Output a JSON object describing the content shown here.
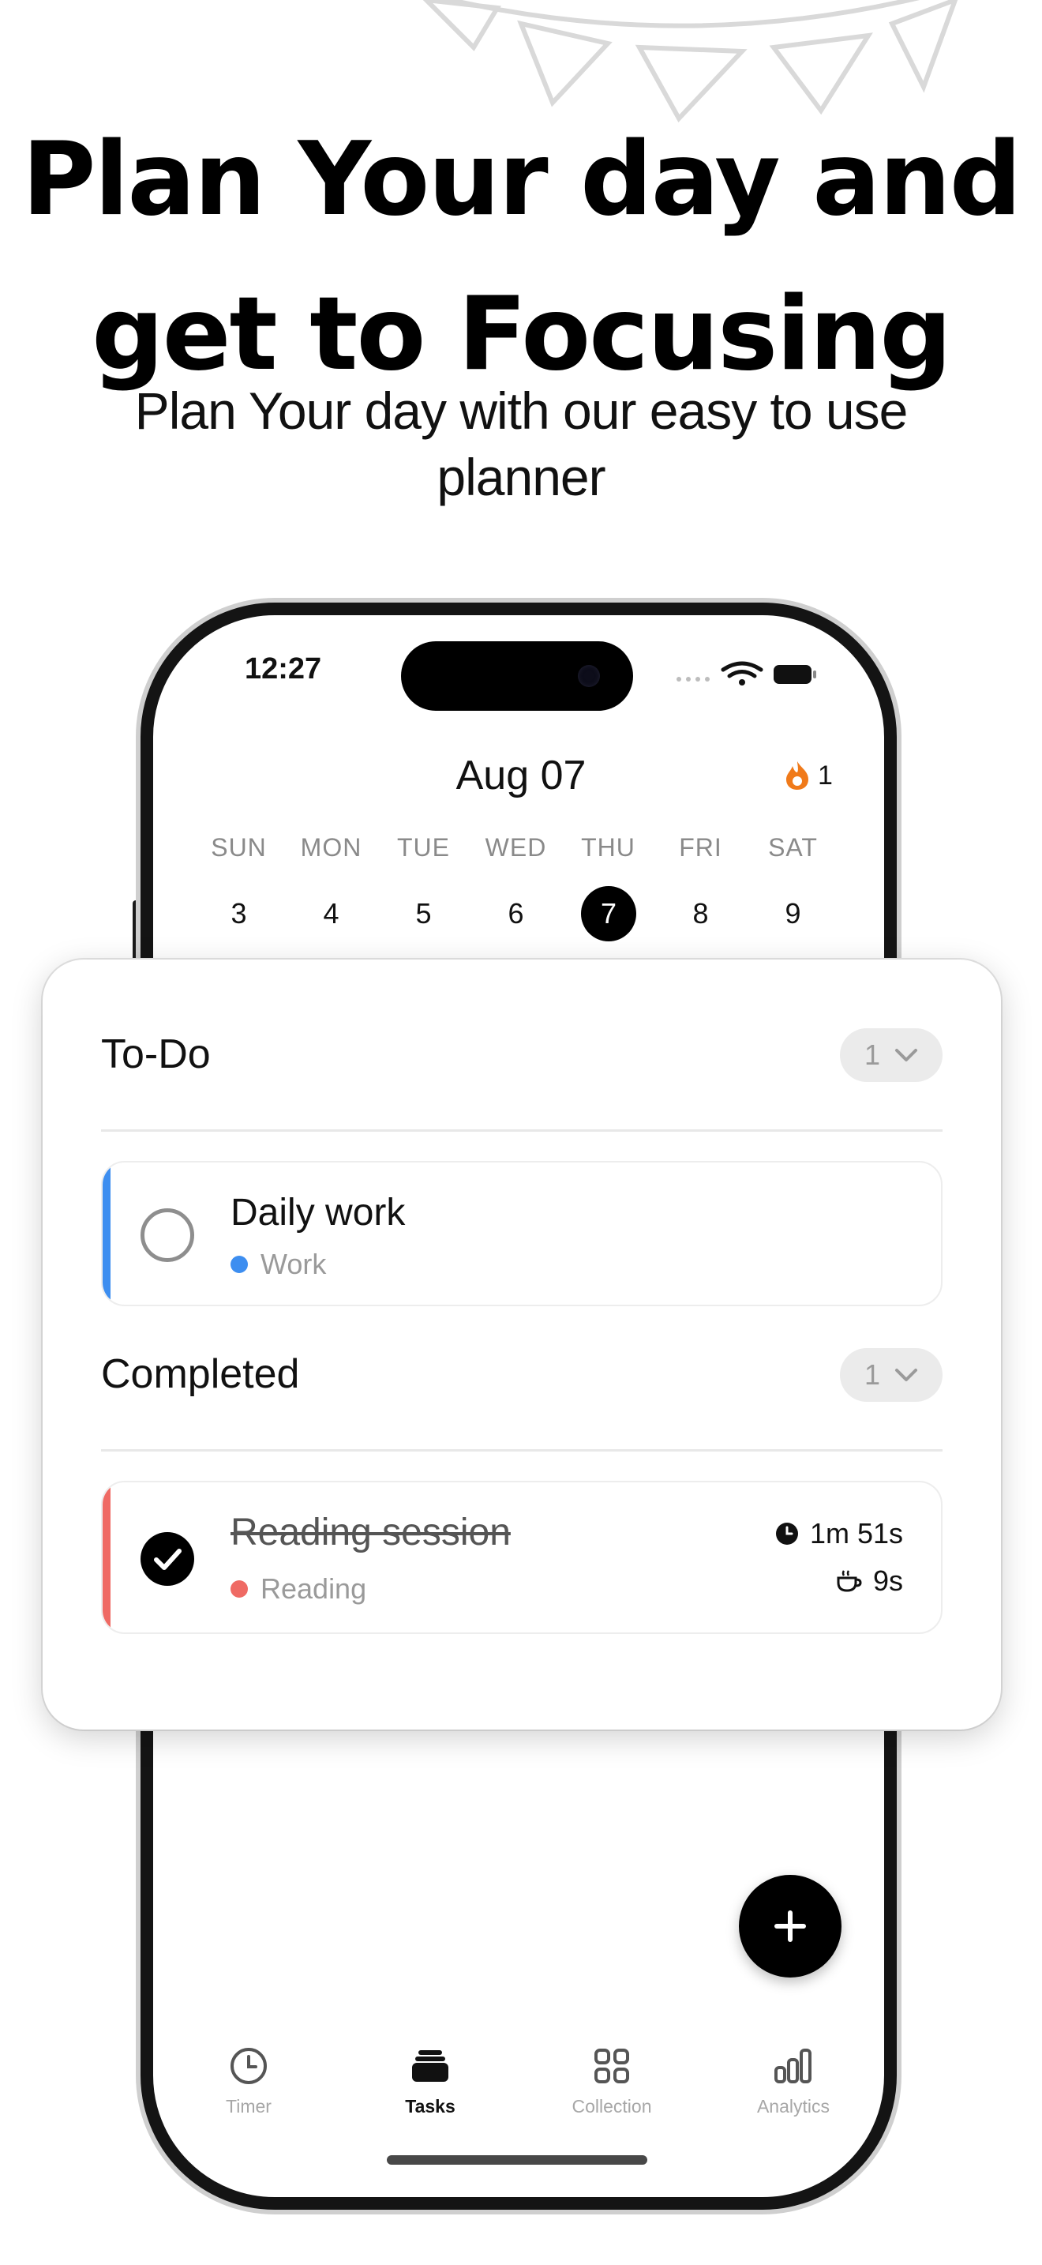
{
  "promo": {
    "headline_line1": "Plan Your day and",
    "headline_line2": "get to Focusing",
    "subheadline": "Plan Your day with our easy to use planner"
  },
  "status_bar": {
    "time": "12:27"
  },
  "calendar": {
    "month_label": "Aug 07",
    "streak_count": "1",
    "weekdays": [
      "SUN",
      "MON",
      "TUE",
      "WED",
      "THU",
      "FRI",
      "SAT"
    ],
    "days": [
      "3",
      "4",
      "5",
      "6",
      "7",
      "8",
      "9"
    ],
    "selected_day": "7"
  },
  "todo": {
    "title": "To-Do",
    "count": "1",
    "tasks": [
      {
        "title": "Daily work",
        "category": "Work",
        "color": "#3d8ef0",
        "completed": false
      }
    ]
  },
  "completed": {
    "title": "Completed",
    "count": "1",
    "tasks": [
      {
        "title": "Reading session",
        "category": "Reading",
        "color": "#ef6a64",
        "completed": true,
        "focus_time": "1m 51s",
        "break_time": "9s"
      }
    ]
  },
  "tabbar": {
    "items": [
      {
        "label": "Timer",
        "icon": "clock-icon",
        "active": false
      },
      {
        "label": "Tasks",
        "icon": "stack-icon",
        "active": true
      },
      {
        "label": "Collection",
        "icon": "grid-icon",
        "active": false
      },
      {
        "label": "Analytics",
        "icon": "bar-chart-icon",
        "active": false
      }
    ]
  },
  "colors": {
    "accent": "#000000",
    "work": "#3d8ef0",
    "reading": "#ef6a64",
    "streak": "#f07a1a"
  }
}
